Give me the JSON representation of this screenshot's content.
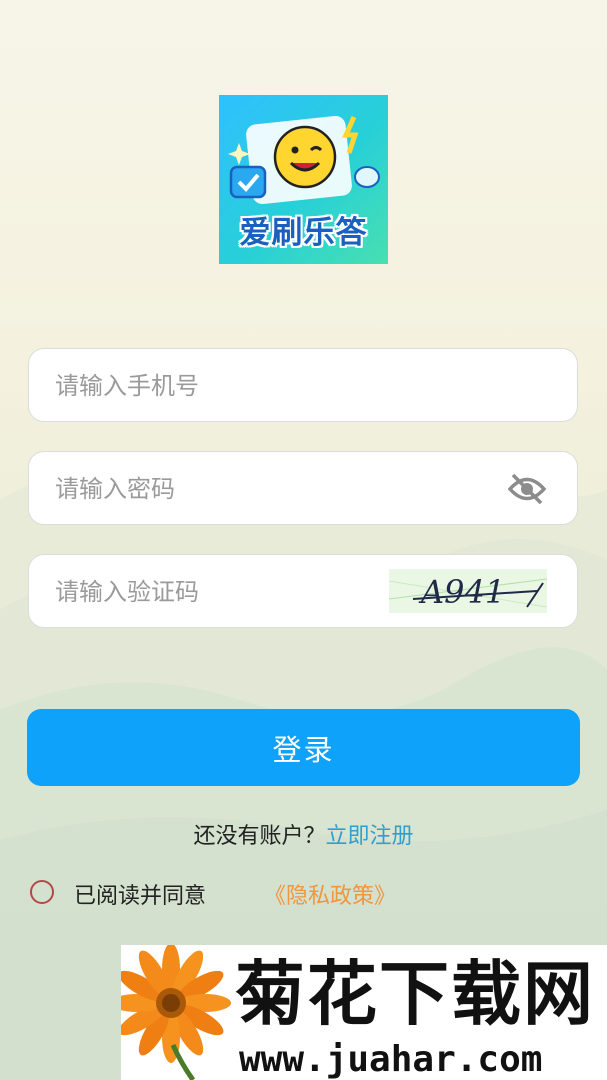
{
  "logo": {
    "text": "爱刷乐答",
    "icon": "app-logo-smiley-quiz",
    "colors": {
      "bg_start": "#2fc0ff",
      "bg_end": "#48e0b0",
      "text": "#1a60c0"
    }
  },
  "form": {
    "phone_placeholder": "请输入手机号",
    "password_placeholder": "请输入密码",
    "password_toggle_icon": "eye-off-icon",
    "captcha_placeholder": "请输入验证码",
    "captcha_text": "A941"
  },
  "login_button": {
    "label": "登录",
    "color": "#0ea2fb"
  },
  "register": {
    "prompt": "还没有账户？",
    "link": "立即注册",
    "link_color": "#2f9fd0"
  },
  "agreement": {
    "checked": false,
    "text": "已阅读并同意",
    "policy_link": "《隐私政策》",
    "policy_color": "#f0963c"
  },
  "watermark": {
    "title": "菊花下载网",
    "url": "www.juahar.com",
    "icon": "flower-logo"
  }
}
